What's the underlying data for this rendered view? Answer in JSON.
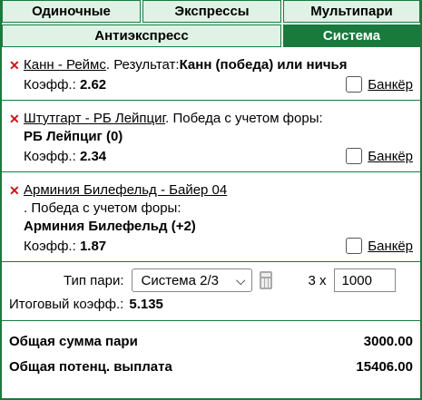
{
  "tabs": {
    "row1": [
      "Одиночные",
      "Экспрессы",
      "Мультипари"
    ],
    "row2": [
      "Антиэкспресс",
      "Система"
    ]
  },
  "bets": [
    {
      "match": "Канн - Реймс",
      "market": ". Результат:",
      "pick": "Канн (победа) или ничья",
      "odds_label": "Коэфф.:",
      "odds": "2.62",
      "banker": "Банкёр"
    },
    {
      "match": "Штутгарт - РБ Лейпциг",
      "market": ". Победа с учетом форы:",
      "pick": "РБ Лейпциг (0)",
      "odds_label": "Коэфф.:",
      "odds": "2.34",
      "banker": "Банкёр"
    },
    {
      "match": "Арминия Билефельд - Байер 04",
      "market": ". Победа с учетом форы:",
      "pick": "Арминия Билефельд (+2)",
      "odds_label": "Коэфф.:",
      "odds": "1.87",
      "banker": "Банкёр"
    }
  ],
  "system": {
    "type_label": "Тип пари:",
    "type_value": "Система 2/3",
    "multiplier": "3 x",
    "stake": "1000",
    "total_odds_label": "Итоговый коэфф.:",
    "total_odds": "5.135"
  },
  "summary": {
    "total_stake_label": "Общая сумма пари",
    "total_stake": "3000.00",
    "potential_label": "Общая потенц. выплата",
    "potential": "15406.00"
  },
  "colors": {
    "accent": "#1a7a3e",
    "tab_bg": "#dff2e5",
    "remove": "#c81818"
  }
}
